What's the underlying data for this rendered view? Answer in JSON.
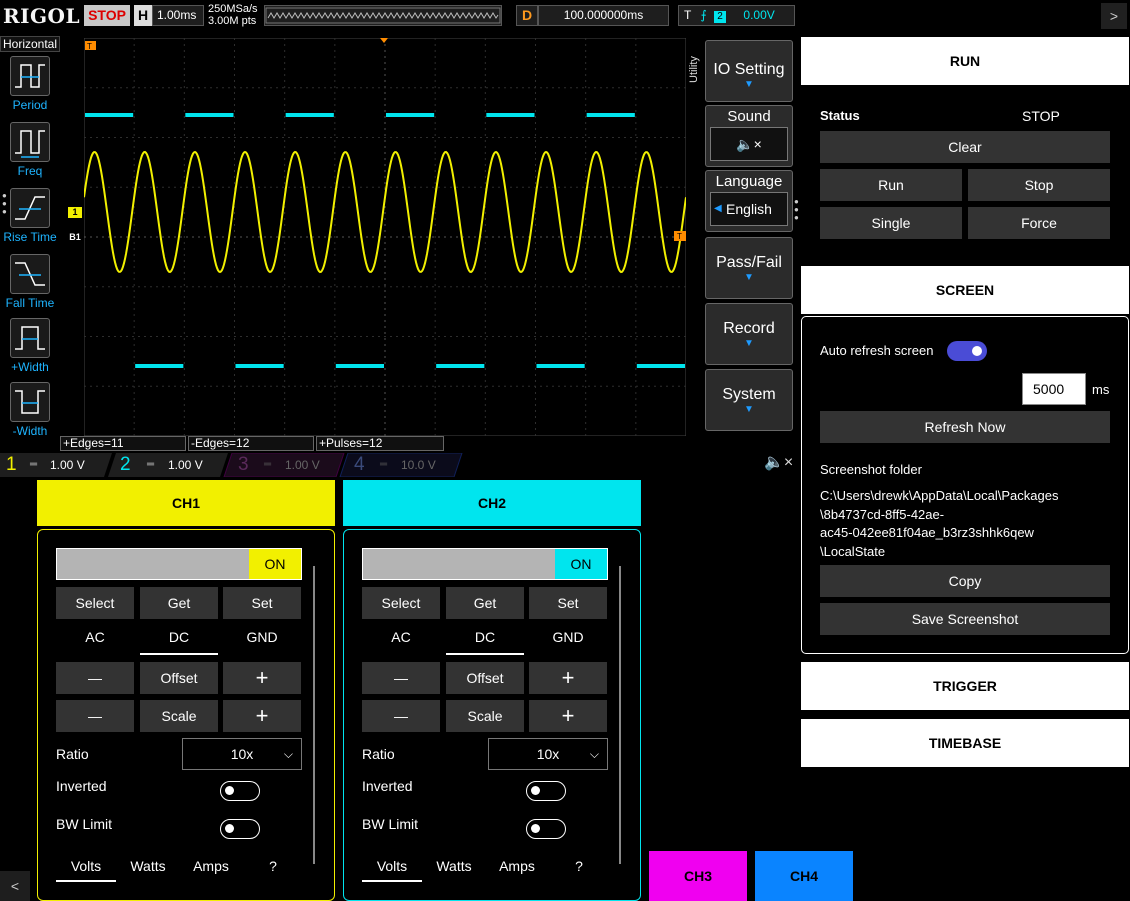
{
  "topbar": {
    "brand": "RIGOL",
    "run_state": "STOP",
    "h_letter": "H",
    "timebase": "1.00ms",
    "sample_rate": "250MSa/s",
    "memory_points": "3.00M pts",
    "d_letter": "D",
    "delay": "100.000000ms",
    "t_letter": "T",
    "trigger_channel": "2",
    "trigger_level": "0.00V",
    "menu_icon": ">"
  },
  "measure_bar": {
    "title": "Horizontal",
    "items": [
      "Period",
      "Freq",
      "Rise Time",
      "Fall Time",
      "+Width",
      "-Width"
    ]
  },
  "bottom_measures": [
    "+Edges=11",
    "-Edges=12",
    "+Pulses=12"
  ],
  "utility_menu": {
    "tab": "Utility",
    "io": "IO Setting",
    "sound": "Sound",
    "language": "Language",
    "language_value": "English",
    "passfail": "Pass/Fail",
    "record": "Record",
    "system": "System"
  },
  "channel_strip": [
    {
      "num": "1",
      "val": "1.00 V",
      "color": "#f2f000"
    },
    {
      "num": "2",
      "val": "1.00 V",
      "color": "#00e5ee"
    },
    {
      "num": "3",
      "val": "1.00 V",
      "color": "#f000f0"
    },
    {
      "num": "4",
      "val": "10.0 V",
      "color": "#1e6bff"
    }
  ],
  "ch1": {
    "title": "CH1",
    "on": "ON",
    "select": "Select",
    "get": "Get",
    "set": "Set",
    "ac": "AC",
    "dc": "DC",
    "gnd": "GND",
    "minus": "—",
    "plus": "+",
    "offset": "Offset",
    "scale": "Scale",
    "ratio_label": "Ratio",
    "ratio": "10x",
    "inverted": "Inverted",
    "bw": "BW Limit",
    "volts": "Volts",
    "watts": "Watts",
    "amps": "Amps",
    "help": "?"
  },
  "ch2": {
    "title": "CH2",
    "on": "ON",
    "select": "Select",
    "get": "Get",
    "set": "Set",
    "ac": "AC",
    "dc": "DC",
    "gnd": "GND",
    "minus": "—",
    "plus": "+",
    "offset": "Offset",
    "scale": "Scale",
    "ratio_label": "Ratio",
    "ratio": "10x",
    "inverted": "Inverted",
    "bw": "BW Limit",
    "volts": "Volts",
    "watts": "Watts",
    "amps": "Amps",
    "help": "?"
  },
  "ch3_label": "CH3",
  "ch4_label": "CH4",
  "back_icon": "<",
  "run": {
    "title": "RUN",
    "status_label": "Status",
    "status_value": "STOP",
    "clear": "Clear",
    "run": "Run",
    "stop": "Stop",
    "single": "Single",
    "force": "Force"
  },
  "screen": {
    "title": "SCREEN",
    "auto_refresh": "Auto refresh screen",
    "interval": "5000",
    "unit": "ms",
    "refresh_now": "Refresh Now",
    "folder_label": "Screenshot folder",
    "folder_line1": "C:\\Users\\drewk\\AppData\\Local\\Packages",
    "folder_line2": "\\8b4737cd-8ff5-42ae-",
    "folder_line3": "ac45-042ee81f04ae_b3rz3shhk6qew",
    "folder_line4": "\\LocalState",
    "copy": "Copy",
    "save": "Save Screenshot"
  },
  "trigger_title": "TRIGGER",
  "timebase_title": "TIMEBASE",
  "colors": {
    "ch1": "#f2f000",
    "ch2": "#00e5ee",
    "ch3": "#f000f0",
    "ch4": "#0a84ff",
    "accent": "#4a4cd6"
  }
}
